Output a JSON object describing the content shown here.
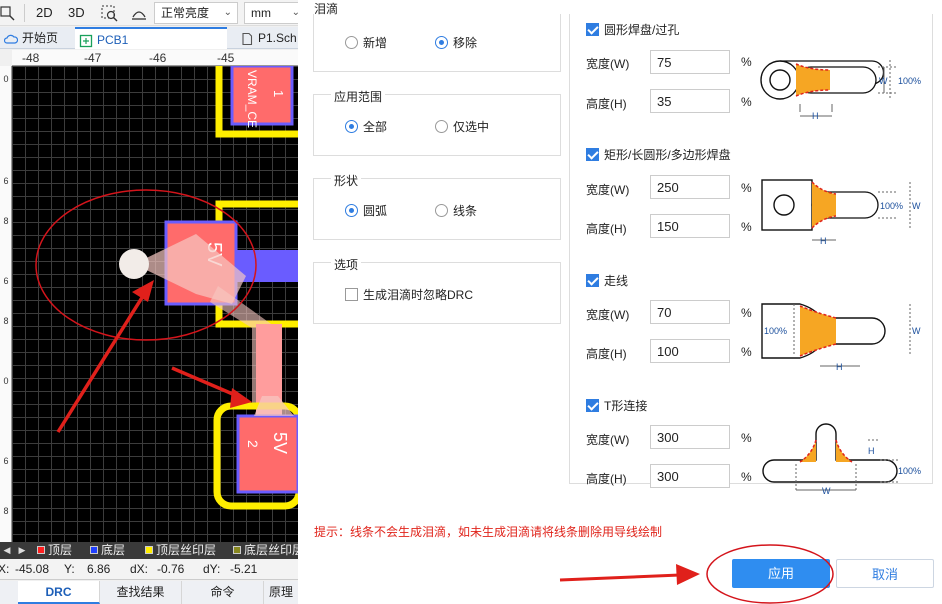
{
  "toolbar": {
    "view_2d": "2D",
    "view_3d": "3D",
    "brightness": "正常亮度",
    "unit": "mm"
  },
  "tabs": [
    {
      "label": "开始页"
    },
    {
      "label": "PCB1"
    },
    {
      "label": "P1.Sch"
    }
  ],
  "ruler": {
    "top": [
      "-48",
      "-47",
      "-46",
      "-45"
    ],
    "left": [
      "0",
      "6",
      "8",
      "6",
      "8",
      "0",
      "6",
      "8"
    ]
  },
  "canvas": {
    "top_text": "VRAM_CE",
    "top_pad_number": "1",
    "pad_net": "5V",
    "bottom_pad_net": "5V",
    "bottom_pad_number": "2",
    "colors": {
      "board": "#000000",
      "outline": "#ffee00",
      "pad": "#ff6b6b",
      "trace": "#6a5cff",
      "teardrop": "#f7c8c2"
    }
  },
  "layers": [
    {
      "label": "顶层",
      "color": "#ff2020"
    },
    {
      "label": "底层",
      "color": "#2040ff"
    },
    {
      "label": "顶层丝印层",
      "color": "#ffee00"
    },
    {
      "label": "底层丝印层",
      "color": "#888820"
    }
  ],
  "coords": {
    "x_label": "X:",
    "x": "-45.08",
    "y_label": "Y:",
    "y": "6.86",
    "dx_label": "dX:",
    "dx": "-0.76",
    "dy_label": "dY:",
    "dy": "-5.21"
  },
  "bottom_tabs": [
    {
      "label": "DRC"
    },
    {
      "label": "查找结果"
    },
    {
      "label": "命令"
    },
    {
      "label": "原理"
    }
  ],
  "dialog": {
    "title": "泪滴",
    "mode": {
      "options": [
        {
          "label": "新增",
          "selected": false
        },
        {
          "label": "移除",
          "selected": true
        }
      ]
    },
    "scope": {
      "title": "应用范围",
      "options": [
        {
          "label": "全部",
          "selected": true
        },
        {
          "label": "仅选中",
          "selected": false
        }
      ]
    },
    "shape": {
      "title": "形状",
      "options": [
        {
          "label": "圆弧",
          "selected": true
        },
        {
          "label": "线条",
          "selected": false
        }
      ]
    },
    "options": {
      "title": "选项",
      "ignore_drc": {
        "label": "生成泪滴时忽略DRC",
        "checked": false
      }
    },
    "sections": [
      {
        "label": "圆形焊盘/过孔",
        "checked": true,
        "width_label": "宽度(W)",
        "width": "75",
        "height_label": "高度(H)",
        "height": "35",
        "unit": "%"
      },
      {
        "label": "矩形/长圆形/多边形焊盘",
        "checked": true,
        "width_label": "宽度(W)",
        "width": "250",
        "height_label": "高度(H)",
        "height": "150",
        "unit": "%"
      },
      {
        "label": "走线",
        "checked": true,
        "width_label": "宽度(W)",
        "width": "70",
        "height_label": "高度(H)",
        "height": "100",
        "unit": "%"
      },
      {
        "label": "T形连接",
        "checked": true,
        "width_label": "宽度(W)",
        "width": "300",
        "height_label": "高度(H)",
        "height": "300",
        "unit": "%"
      }
    ],
    "illustration_labels": {
      "w": "W",
      "h": "H",
      "pct": "100%"
    },
    "hint": "提示：线条不会生成泪滴，如未生成泪滴请将线条删除用导线绘制",
    "apply_label": "应用",
    "cancel_label": "取消",
    "accent": "#2f8df0",
    "hint_color": "#e0241b"
  }
}
